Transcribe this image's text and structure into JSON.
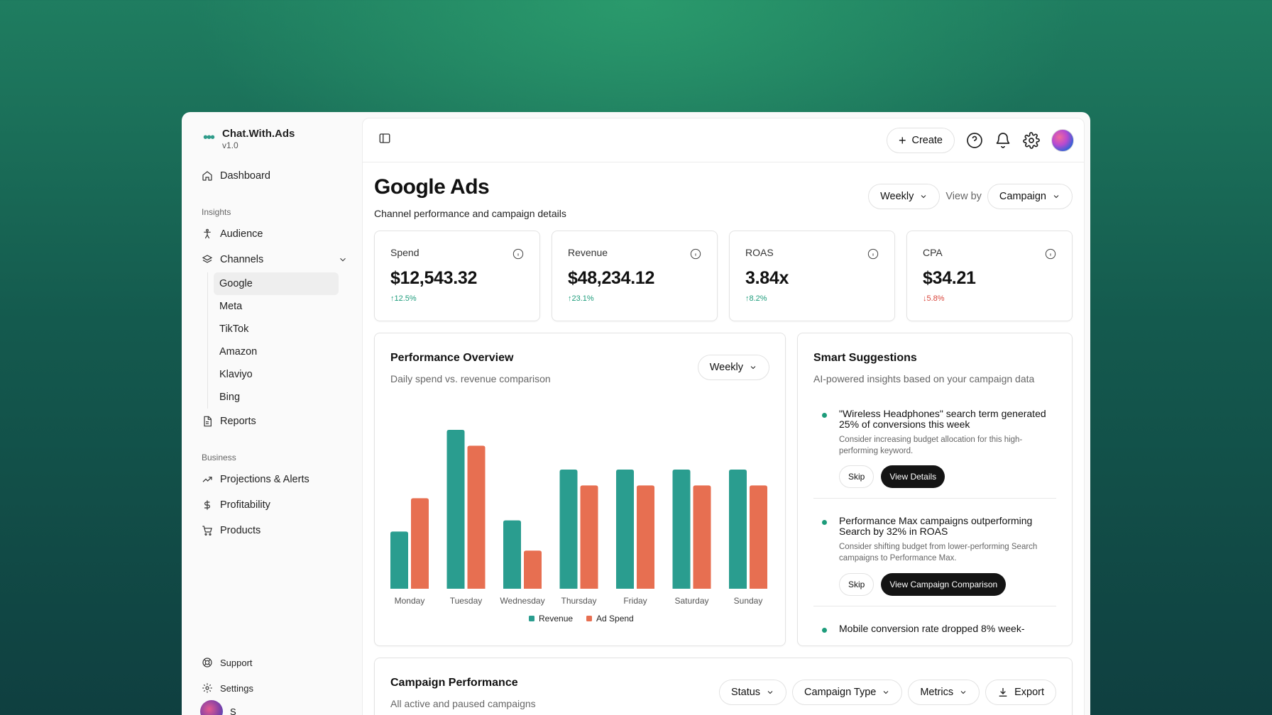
{
  "brand": {
    "name": "Chat.With.Ads",
    "version": "v1.0"
  },
  "sidebar": {
    "dashboard": "Dashboard",
    "insights_label": "Insights",
    "audience": "Audience",
    "channels": "Channels",
    "channel_items": [
      "Google",
      "Meta",
      "TikTok",
      "Amazon",
      "Klaviyo",
      "Bing"
    ],
    "reports": "Reports",
    "business_label": "Business",
    "projections": "Projections & Alerts",
    "profitability": "Profitability",
    "products": "Products",
    "support": "Support",
    "settings": "Settings",
    "user_initial": "S"
  },
  "topbar": {
    "create_label": "Create"
  },
  "page": {
    "title": "Google Ads",
    "subtitle": "Channel performance and campaign details",
    "period": "Weekly",
    "view_by_label": "View by",
    "view_by_value": "Campaign"
  },
  "kpis": [
    {
      "label": "Spend",
      "value": "$12,543.32",
      "delta": "↑12.5%",
      "trend": "up"
    },
    {
      "label": "Revenue",
      "value": "$48,234.12",
      "delta": "↑23.1%",
      "trend": "up"
    },
    {
      "label": "ROAS",
      "value": "3.84x",
      "delta": "↑8.2%",
      "trend": "up"
    },
    {
      "label": "CPA",
      "value": "$34.21",
      "delta": "↓5.8%",
      "trend": "down"
    }
  ],
  "performance": {
    "title": "Performance Overview",
    "subtitle": "Daily spend vs. revenue comparison",
    "period": "Weekly"
  },
  "chart_data": {
    "type": "bar",
    "categories": [
      "Monday",
      "Tuesday",
      "Wednesday",
      "Thursday",
      "Friday",
      "Saturday",
      "Sunday"
    ],
    "series": [
      {
        "name": "Revenue",
        "color": "#2a9d8f",
        "values": [
          36,
          100,
          43,
          75,
          75,
          75,
          75
        ]
      },
      {
        "name": "Ad Spend",
        "color": "#e76f51",
        "values": [
          57,
          90,
          24,
          65,
          65,
          65,
          65
        ]
      }
    ],
    "ylim": [
      0,
      100
    ],
    "grid": false,
    "legend": "bottom-center"
  },
  "suggestions": {
    "title": "Smart Suggestions",
    "subtitle": "AI-powered insights based on your campaign data",
    "items": [
      {
        "headline": "\"Wireless Headphones\" search term generated 25% of conversions this week",
        "body": "Consider increasing budget allocation for this high-performing keyword.",
        "skip": "Skip",
        "action": "View Details"
      },
      {
        "headline": "Performance Max campaigns outperforming Search by 32% in ROAS",
        "body": "Consider shifting budget from lower-performing Search campaigns to Performance Max.",
        "skip": "Skip",
        "action": "View Campaign Comparison"
      },
      {
        "headline": "Mobile conversion rate dropped 8% week-",
        "body": "",
        "skip": "",
        "action": ""
      }
    ]
  },
  "campaign": {
    "title": "Campaign Performance",
    "subtitle": "All active and paused campaigns",
    "filters": [
      "Status",
      "Campaign Type",
      "Metrics"
    ],
    "export": "Export"
  }
}
